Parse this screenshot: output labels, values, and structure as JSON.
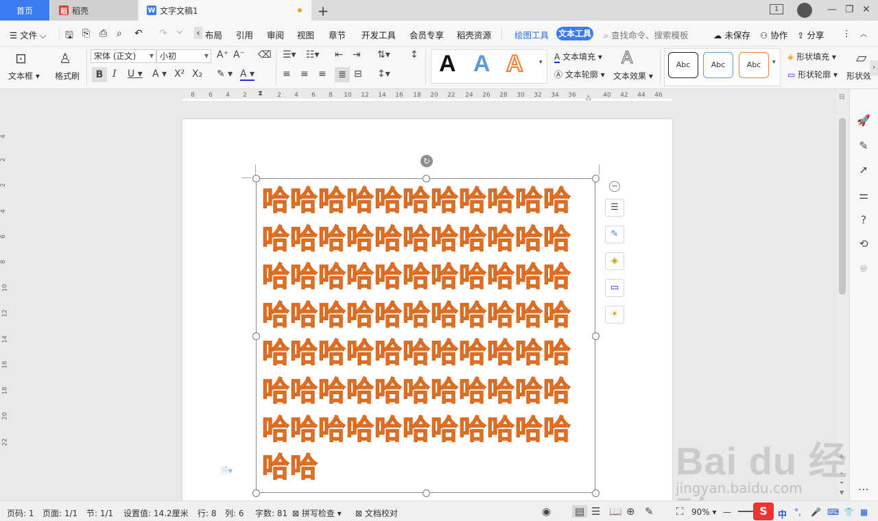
{
  "tabs": {
    "home": "首页",
    "daoke": "稻壳",
    "doc": "文字文稿1",
    "page_indicator": "1"
  },
  "menu": {
    "file": "文件",
    "items": [
      "布局",
      "引用",
      "审阅",
      "视图",
      "章节",
      "开发工具",
      "会员专享",
      "稻壳资源"
    ],
    "drawing_tools": "绘图工具",
    "text_tools": "文本工具",
    "search_placeholder": "查找命令、搜索模板",
    "unsaved": "未保存",
    "collaborate": "协作",
    "share": "分享"
  },
  "ribbon": {
    "textbox": "文本框",
    "format_painter": "格式刷",
    "font_name": "宋体 (正文)",
    "font_size": "小初",
    "text_fill": "文本填充",
    "text_outline": "文本轮廓",
    "text_effect": "文本效果",
    "style_sample": "Abc",
    "shape_fill": "形状填充",
    "shape_outline": "形状轮廓",
    "shape_effect": "形状效"
  },
  "ruler": {
    "h_ticks": [
      "8",
      "6",
      "4",
      "2",
      "2",
      "4",
      "6",
      "8",
      "10",
      "12",
      "14",
      "16",
      "18",
      "20",
      "22",
      "24",
      "26",
      "28",
      "30",
      "32",
      "34",
      "36",
      "40",
      "42",
      "44",
      "46"
    ],
    "v_ticks": [
      "4",
      "2",
      "2",
      "4",
      "6",
      "8",
      "10",
      "12",
      "14",
      "16",
      "18",
      "20",
      "22"
    ]
  },
  "document": {
    "text": "哈哈哈哈哈哈哈哈哈哈哈哈哈哈哈哈哈哈哈哈哈哈哈哈哈哈哈哈哈哈哈哈哈哈哈哈哈哈哈哈哈哈哈哈哈哈哈哈哈哈哈哈哈哈哈哈哈哈哈哈哈哈哈哈哈哈哈哈哈哈哈哈哈哈哈哈哈哈哈",
    "text_color": "#f28f4b",
    "outline_color": "#d96a1f"
  },
  "status": {
    "page_num": "页码: 1",
    "pages": "页面: 1/1",
    "section": "节: 1/1",
    "setting": "设置值: 14.2厘米",
    "row": "行: 8",
    "col": "列: 6",
    "word_count": "字数: 81",
    "spell_check": "拼写检查",
    "doc_proof": "文档校对",
    "zoom": "90%",
    "ime": "中"
  },
  "watermark": {
    "logo": "Bai du 经验",
    "url": "jingyan.baidu.com"
  },
  "colors": {
    "accent": "#3c7cf2",
    "text_orange": "#f28f4b"
  }
}
